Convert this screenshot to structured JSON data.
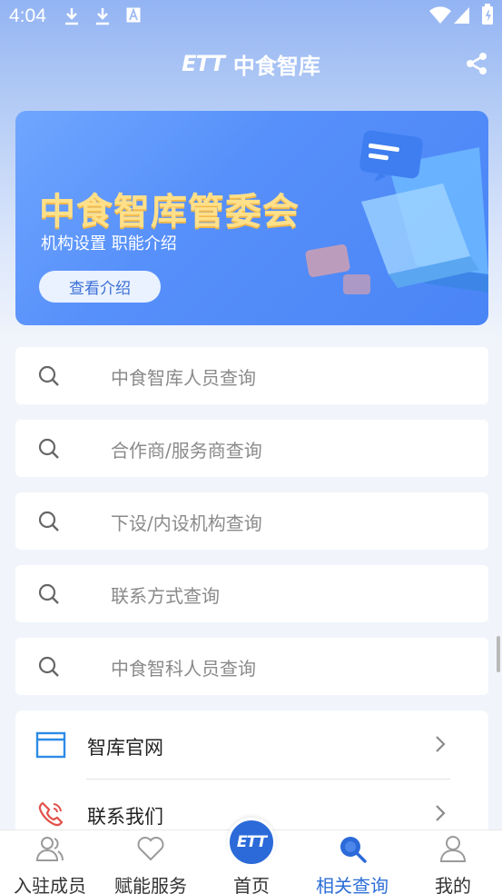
{
  "status_bar": {
    "time": "4:04",
    "icons": [
      "download-icon",
      "download-icon",
      "font-icon",
      "wifi-icon",
      "signal-icon",
      "battery-icon"
    ]
  },
  "header": {
    "logo": "ETT",
    "title": "中食智库",
    "share_icon": "share-icon"
  },
  "banner": {
    "title": "中食智库管委会",
    "subtitle": "机构设置 职能介绍",
    "button_label": "查看介绍"
  },
  "queries": [
    {
      "label": "中食智库人员查询",
      "icon": "search-icon"
    },
    {
      "label": "合作商/服务商查询",
      "icon": "search-icon"
    },
    {
      "label": "下设/内设机构查询",
      "icon": "search-icon"
    },
    {
      "label": "联系方式查询",
      "icon": "search-icon"
    },
    {
      "label": "中食智科人员查询",
      "icon": "search-icon"
    }
  ],
  "links": [
    {
      "label": "智库官网",
      "icon": "browser-window-icon"
    },
    {
      "label": "联系我们",
      "icon": "phone-icon"
    }
  ],
  "bottom_nav": [
    {
      "label": "入驻成员",
      "icon": "members-icon",
      "active": false
    },
    {
      "label": "赋能服务",
      "icon": "heart-icon",
      "active": false
    },
    {
      "label": "首页",
      "icon": "home-logo-icon",
      "active": false,
      "logo": "ETT"
    },
    {
      "label": "相关查询",
      "icon": "query-icon",
      "active": true
    },
    {
      "label": "我的",
      "icon": "profile-icon",
      "active": false
    }
  ],
  "colors": {
    "accent": "#2d6fd6",
    "banner_title": "#ffe08a",
    "phone_icon": "#e2504a"
  }
}
